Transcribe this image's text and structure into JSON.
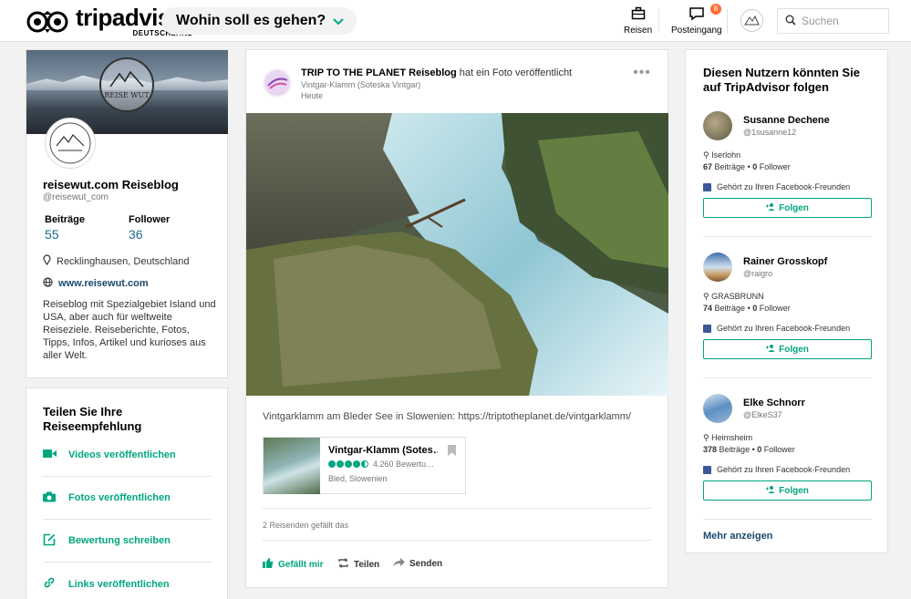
{
  "header": {
    "logo_text": "tripadvisor",
    "logo_sub": "DEUTSCHLAND",
    "where_label": "Wohin soll es gehen?",
    "trips_label": "Reisen",
    "inbox_label": "Posteingang",
    "inbox_badge": "8",
    "search_placeholder": "Suchen"
  },
  "profile": {
    "name": "reisewut.com Reiseblog",
    "handle": "@reisewut_com",
    "contributions_label": "Beiträge",
    "contributions": "55",
    "followers_label": "Follower",
    "followers": "36",
    "location": "Recklinghausen, Deutschland",
    "website": "www.reisewut.com",
    "bio": "Reiseblog mit Spezialgebiet Island und USA, aber auch für weltweite Reiseziele. Reiseberichte, Fotos, Tipps, Infos, Artikel und kurioses aus aller Welt.",
    "cover_logo_text": "REISE WUT"
  },
  "share": {
    "title": "Teilen Sie Ihre Reiseempfehlung",
    "items": [
      {
        "label": "Videos veröffentlichen",
        "icon": "video-icon"
      },
      {
        "label": "Fotos veröffentlichen",
        "icon": "camera-icon"
      },
      {
        "label": "Bewertung schreiben",
        "icon": "edit-icon"
      },
      {
        "label": "Links veröffentlichen",
        "icon": "link-icon"
      }
    ]
  },
  "post": {
    "author": "TRIP TO THE PLANET Reiseblog",
    "action": "hat ein Foto veröffentlicht",
    "place": "Vintgar-Klamm (Soteska Vintgar)",
    "time": "Heute",
    "caption": "Vintgarklamm am Bleder See in Slowenien: https://triptotheplanet.de/vintgarklamm/",
    "poi": {
      "name": "Vintgar-Klamm (Sotes…",
      "rating": 4.5,
      "reviews": "4.260 Bewertu…",
      "location": "Bled, Slowenien"
    },
    "likes": "2 Reisenden gefällt das",
    "like_label": "Gefällt mir",
    "share_label": "Teilen",
    "send_label": "Senden"
  },
  "follow": {
    "title": "Diesen Nutzern könnten Sie auf TripAdvisor folgen",
    "users": [
      {
        "name": "Susanne Dechene",
        "handle": "@1susanne12",
        "location": "Iserlohn",
        "contributions": "67",
        "followers": "0",
        "fb": "Gehört zu Ihren Facebook-Freunden",
        "button": "Folgen"
      },
      {
        "name": "Rainer Grosskopf",
        "handle": "@raigro",
        "location": "GRASBRUNN",
        "contributions": "74",
        "followers": "0",
        "fb": "Gehört zu Ihren Facebook-Freunden",
        "button": "Folgen"
      },
      {
        "name": "Elke Schnorr",
        "handle": "@ElkeS37",
        "location": "Heimsheim",
        "contributions": "378",
        "followers": "0",
        "fb": "Gehört zu Ihren Facebook-Freunden",
        "button": "Folgen"
      }
    ],
    "stats_contrib_suffix": "Beiträge",
    "stats_follower_suffix": "Follower",
    "more_label": "Mehr anzeigen"
  },
  "colors": {
    "accent": "#00a680",
    "link": "#1a4a6e",
    "stat": "#1a6c8c",
    "badge": "#ff6a33",
    "facebook": "#3b5998"
  }
}
